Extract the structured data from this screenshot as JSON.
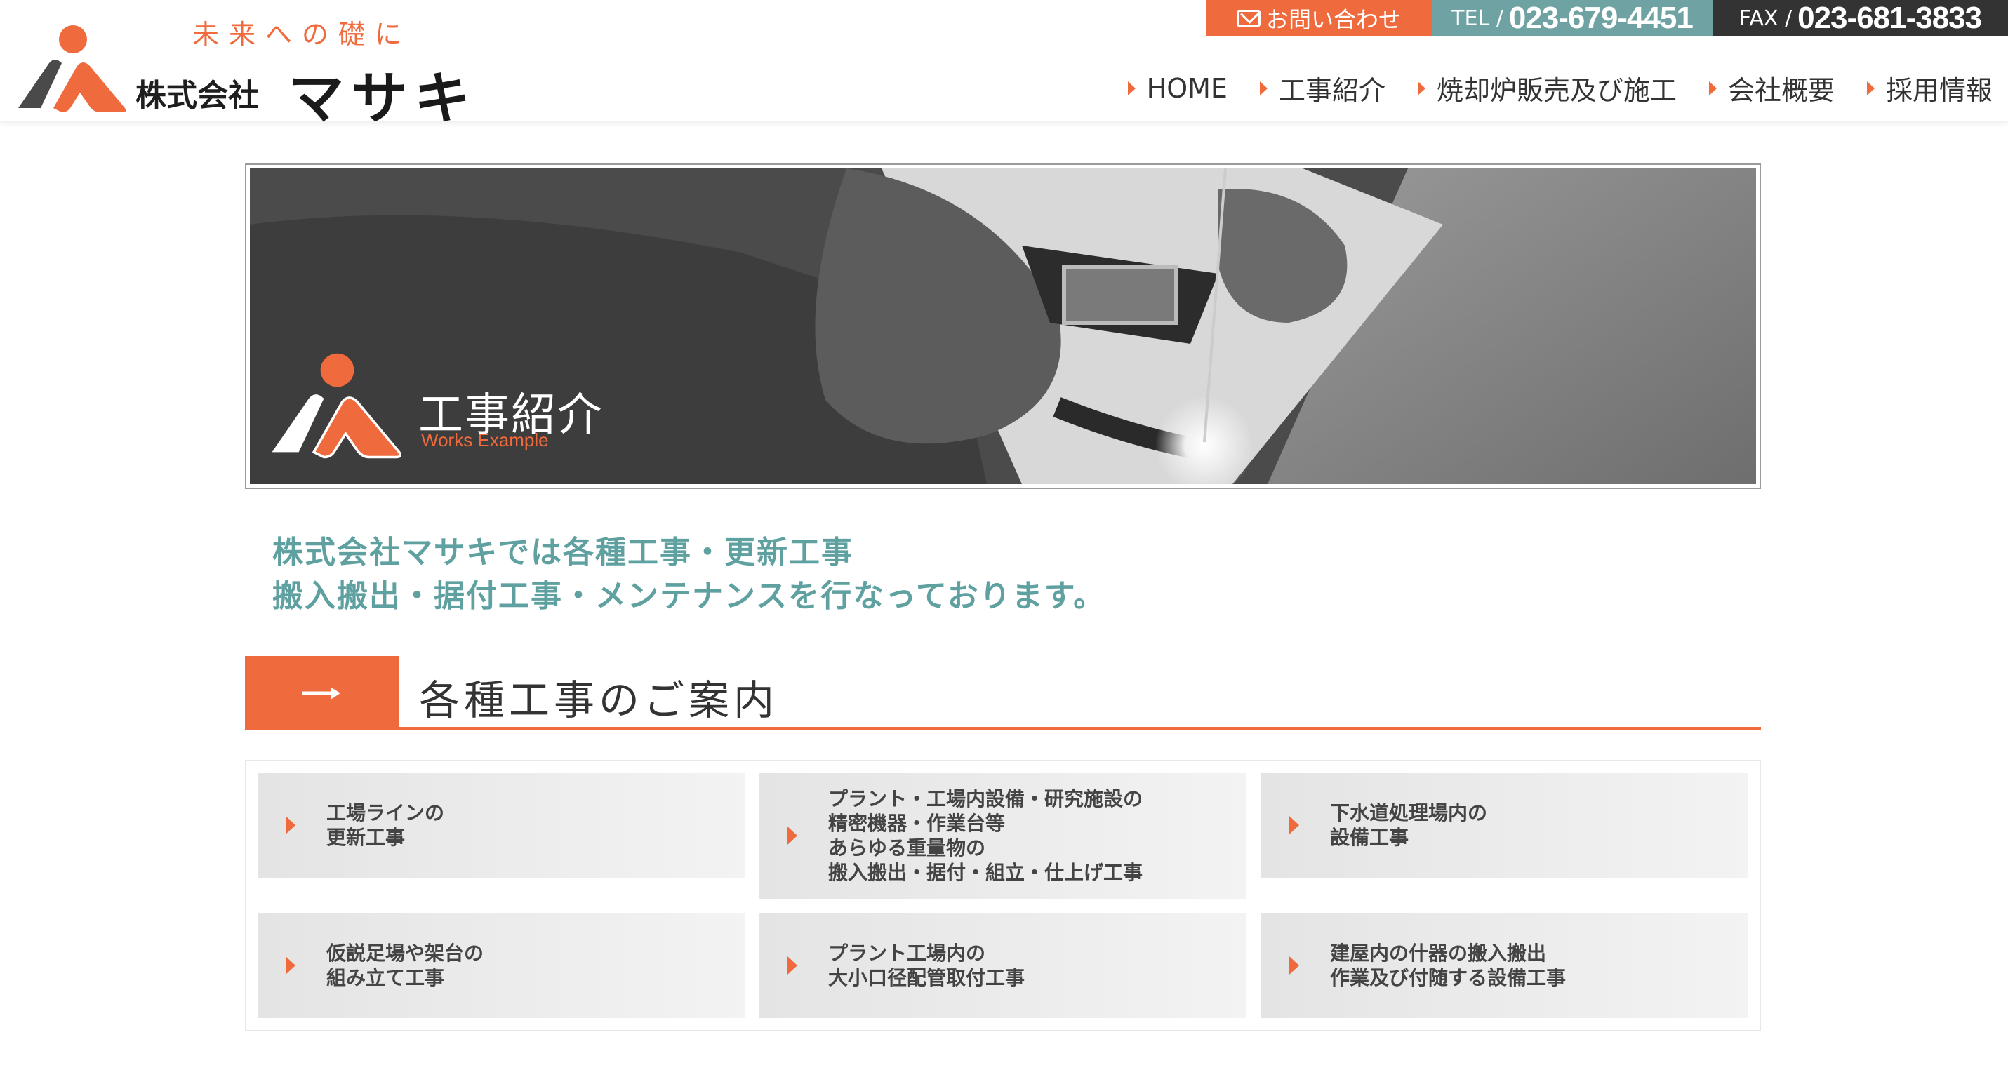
{
  "header": {
    "tagline": "未来への礎に",
    "company_prefix": "株式会社",
    "company_name": "マサキ",
    "contact": {
      "mail_label": "お問い合わせ",
      "tel_label": "TEL /",
      "tel_number": "023-679-4451",
      "fax_label": "FAX /",
      "fax_number": "023-681-3833"
    },
    "nav": [
      {
        "label": "HOME"
      },
      {
        "label": "工事紹介"
      },
      {
        "label": "焼却炉販売及び施工"
      },
      {
        "label": "会社概要"
      },
      {
        "label": "採用情報"
      }
    ]
  },
  "banner": {
    "title_ja": "工事紹介",
    "title_en": "Works Example"
  },
  "intro": {
    "line1": "株式会社マサキでは各種工事・更新工事",
    "line2": "搬入搬出・据付工事・メンテナンスを行なっております。"
  },
  "section": {
    "title": "各種工事のご案内"
  },
  "services": [
    {
      "text": "工場ラインの\n更新工事"
    },
    {
      "text": "プラント・工場内設備・研究施設の\n精密機器・作業台等\nあらゆる重量物の\n搬入搬出・据付・組立・仕上げ工事"
    },
    {
      "text": "下水道処理場内の\n設備工事"
    },
    {
      "text": "仮説足場や架台の\n組み立て工事"
    },
    {
      "text": "プラント工場内の\n大小口径配管取付工事"
    },
    {
      "text": "建屋内の什器の搬入搬出\n作業及び付随する設備工事"
    }
  ],
  "colors": {
    "accent": "#ef6a3c",
    "teal": "#6fa3a3",
    "dark": "#333333",
    "intro_text": "#5fa0a0"
  }
}
